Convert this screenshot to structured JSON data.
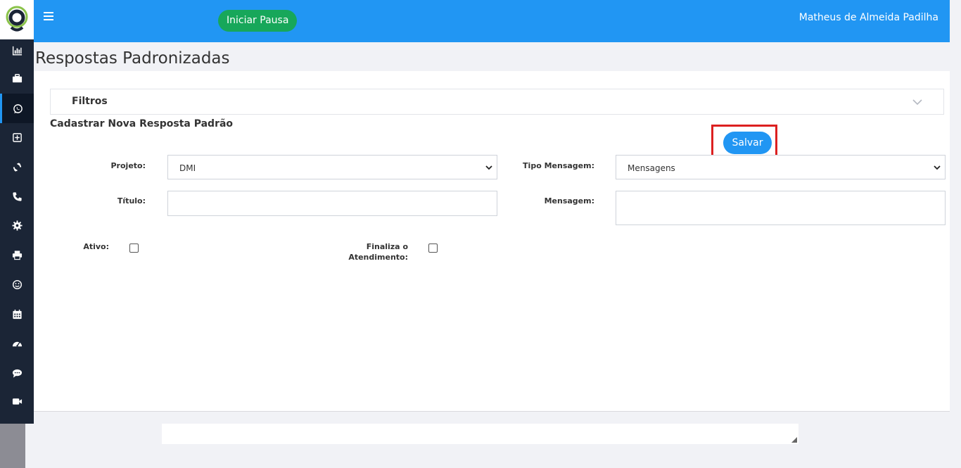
{
  "header": {
    "pause_button": "Iniciar Pausa",
    "user_name": "Matheus de Almeida Padilha"
  },
  "sidebar": {
    "items": [
      {
        "icon": "bar-chart-icon"
      },
      {
        "icon": "briefcase-icon"
      },
      {
        "icon": "whatsapp-icon",
        "active": true
      },
      {
        "icon": "plus-square-icon"
      },
      {
        "icon": "refresh-icon"
      },
      {
        "icon": "phone-icon"
      },
      {
        "icon": "gear-icon"
      },
      {
        "icon": "printer-icon"
      },
      {
        "icon": "smile-icon"
      },
      {
        "icon": "calendar-icon"
      },
      {
        "icon": "dashboard-icon"
      },
      {
        "icon": "chat-icon"
      },
      {
        "icon": "video-icon"
      }
    ]
  },
  "page": {
    "title": "Respostas Padronizadas",
    "filters_label": "Filtros",
    "section_title": "Cadastrar Nova Resposta Padrão",
    "save_button": "Salvar"
  },
  "form": {
    "projeto_label": "Projeto:",
    "projeto_value": "DMI",
    "tipo_label": "Tipo Mensagem:",
    "tipo_value": "Mensagens",
    "titulo_label": "Título:",
    "titulo_value": "",
    "mensagem_label": "Mensagem:",
    "mensagem_value": "",
    "ativo_label": "Ativo:",
    "finaliza_label_1": "Finaliza o",
    "finaliza_label_2": "Atendimento:"
  },
  "colors": {
    "topbar": "#2196f3",
    "sidebar": "#1b2536",
    "pause_button": "#17a75a",
    "save_highlight": "#dc2020"
  }
}
